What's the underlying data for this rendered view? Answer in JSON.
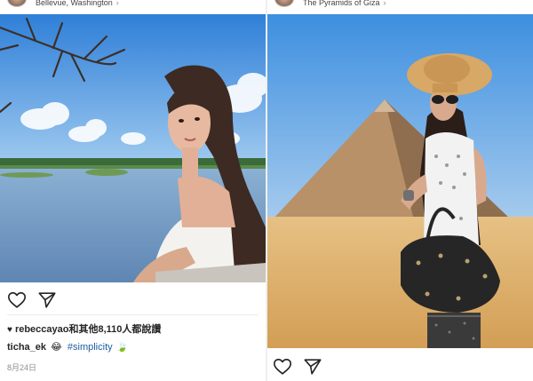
{
  "left_post": {
    "location": "Bellevue, Washington",
    "likes_text": "rebeccayao和其他8,110人都說讚",
    "caption": {
      "username": "ticha_ek",
      "emoji": "😂",
      "hashtag": "#simplicity",
      "trailing_emoji": "🍃"
    },
    "date": "8月24日"
  },
  "right_post": {
    "location": "The Pyramids of Giza"
  },
  "icons": {
    "heart": "heart-outline-icon",
    "share": "paper-plane-icon",
    "chevron": "chevron-right-icon"
  },
  "glyphs": {
    "chevron": "›",
    "filled_heart": "♥"
  },
  "colors": {
    "hashtag": "#1d5fa0",
    "sky": "#4f9be0",
    "water": "#7a9fc4",
    "sand": "#dfb06a"
  }
}
